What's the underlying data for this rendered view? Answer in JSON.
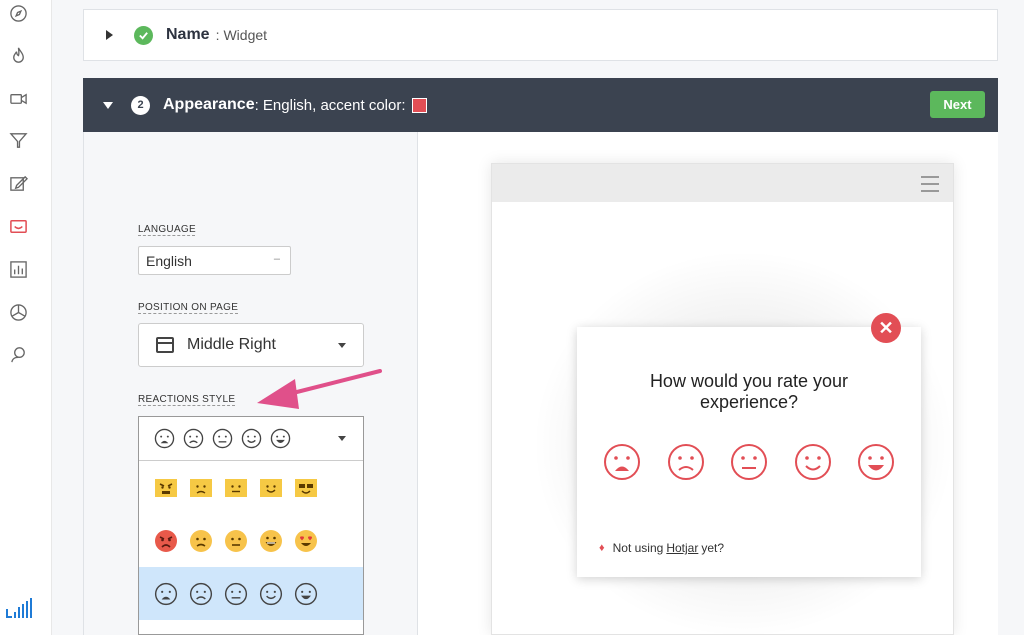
{
  "sidebar": {
    "icons": [
      "compass-icon",
      "flame-icon",
      "video-camera-icon",
      "funnel-icon",
      "edit-icon",
      "feedback-widget-icon",
      "bar-chart-icon",
      "pie-chart-icon",
      "user-icon"
    ],
    "active": "feedback-widget-icon",
    "active_color": "#e24e55"
  },
  "name_step": {
    "title": "Name",
    "separator": ":",
    "value": "Widget"
  },
  "appearance_step": {
    "number": "2",
    "title": "Appearance",
    "summary": ": English, accent color:",
    "accent_color": "#e24e55",
    "next_label": "Next"
  },
  "form": {
    "language_label": "LANGUAGE",
    "language_value": "English",
    "position_label": "POSITION ON PAGE",
    "position_value": "Middle Right",
    "reactions_label": "REACTIONS STYLE"
  },
  "reaction_styles": [
    "outline-grey",
    "yellow-square",
    "emoji-color",
    "outline-grey"
  ],
  "selected_reaction_style": "outline-grey",
  "preview": {
    "question": "How would you rate your experience?",
    "close_label": "✕",
    "footer_prefix": "Not using",
    "footer_link": "Hotjar",
    "footer_suffix": "yet?"
  }
}
